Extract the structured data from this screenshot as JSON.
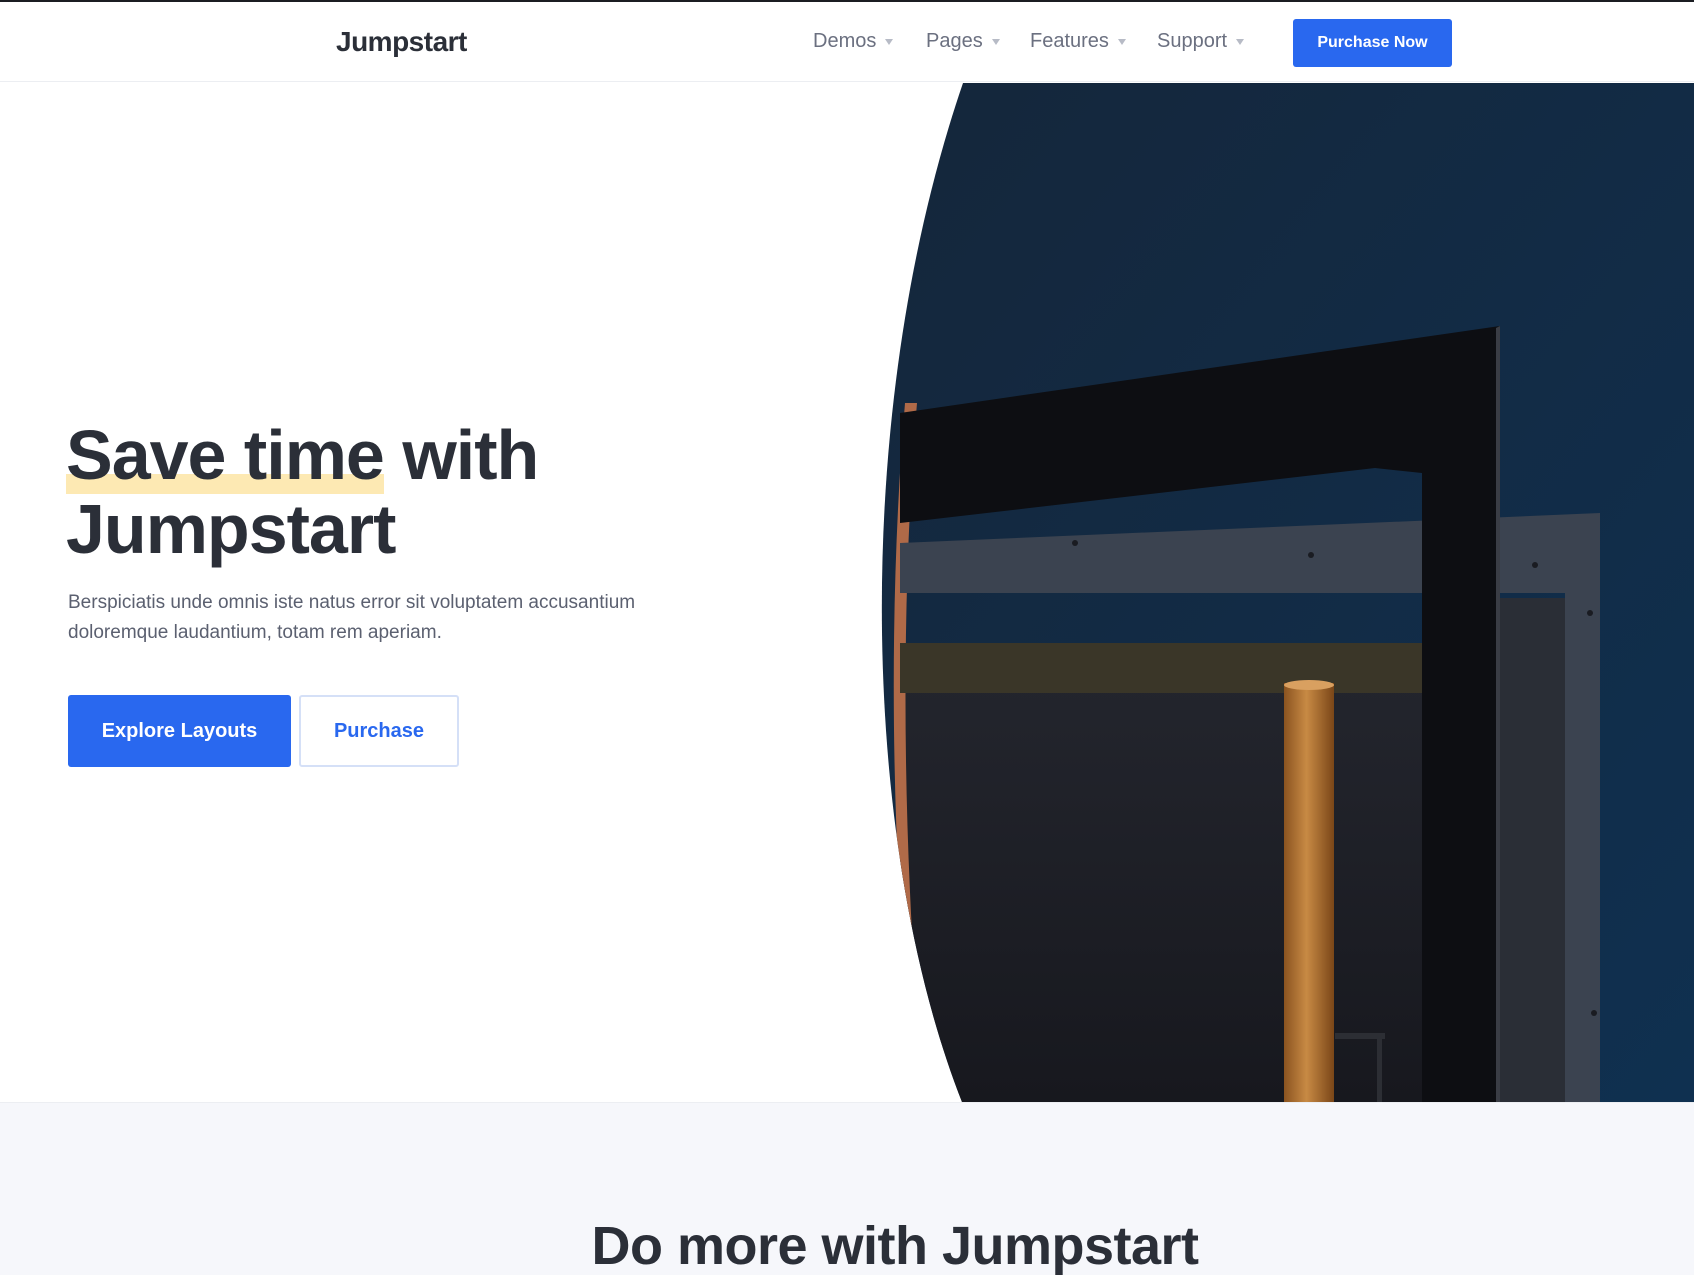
{
  "brand": {
    "logo": "Jumpstart"
  },
  "nav": {
    "items": [
      {
        "label": "Demos"
      },
      {
        "label": "Pages"
      },
      {
        "label": "Features"
      },
      {
        "label": "Support"
      }
    ],
    "cta_label": "Purchase Now"
  },
  "hero": {
    "title_highlight": "Save time",
    "title_rest": " with",
    "title_line2": "Jumpstart",
    "subtitle": "Berspiciatis unde omnis iste natus error sit voluptatem accusantium doloremque laudantium, totam rem aperiam.",
    "primary_button": "Explore Layouts",
    "secondary_button": "Purchase"
  },
  "features": {
    "title": "Do more with Jumpstart"
  },
  "colors": {
    "accent": "#2968ef",
    "highlight": "#fde9b3",
    "text": "#2b2f38",
    "muted": "#6b7080",
    "section_bg": "#f6f7fb"
  }
}
